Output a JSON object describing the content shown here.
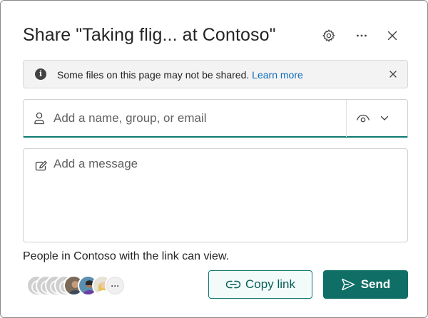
{
  "dialog": {
    "title": "Share \"Taking flig... at Contoso\"",
    "icons": {
      "settings": "gear-icon",
      "more": "ellipsis-icon",
      "close": "close-icon"
    }
  },
  "banner": {
    "icon": "info-icon",
    "message": "Some files on this page may not be shared.",
    "link_label": "Learn more",
    "dismiss_icon": "close-icon"
  },
  "people_picker": {
    "placeholder": "Add a name, group, or email",
    "value": "",
    "permission_icon": "eye-icon"
  },
  "message": {
    "placeholder": "Add a message",
    "value": ""
  },
  "link_scope_text": "People in Contoso with the link can view.",
  "avatars": {
    "more_label": "···"
  },
  "actions": {
    "copy_link_label": "Copy link",
    "send_label": "Send"
  },
  "colors": {
    "accent": "#0f6e66",
    "link": "#0f6cbd",
    "banner_bg": "#f3f3f3"
  }
}
